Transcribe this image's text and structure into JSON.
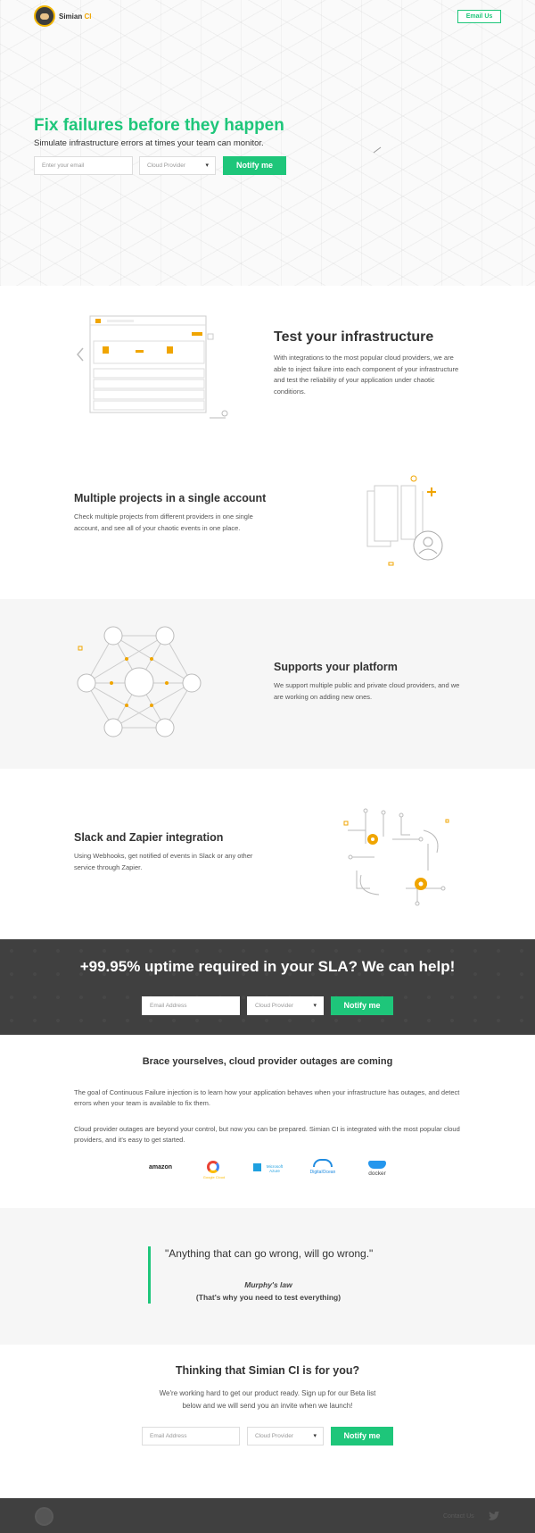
{
  "header": {
    "brand_main": "Simian",
    "brand_accent": "CI",
    "email_us": "Email Us"
  },
  "hero": {
    "title": "Fix failures before they happen",
    "subtitle": "Simulate infrastructure errors at times your team can monitor.",
    "email_placeholder": "Enter your email",
    "provider": "Cloud Provider",
    "notify": "Notify me"
  },
  "features": [
    {
      "title": "Test your infrastructure",
      "text": "With integrations to the most popular cloud providers, we are able to inject failure into each component of your infrastructure and test the reliability of your application under chaotic conditions."
    },
    {
      "title": "Multiple projects in a single account",
      "text": "Check multiple projects from different providers in one single account, and see all of your chaotic events in one place."
    },
    {
      "title": "Supports your platform",
      "text": "We support multiple public and private cloud providers, and we are working on adding new ones."
    },
    {
      "title": "Slack and Zapier integration",
      "text": "Using Webhooks, get notified of events in Slack or any other service through Zapier."
    }
  ],
  "cta": {
    "title": "+99.95% uptime required in your SLA? We can help!",
    "email_placeholder": "Email Address",
    "provider": "Cloud Provider",
    "notify": "Notify me"
  },
  "outages": {
    "title": "Brace yourselves, cloud provider outages are coming",
    "p1": "The goal of Continuous Failure injection is to learn how your application behaves when your infrastructure has outages, and detect errors when your team is available to fix them.",
    "p2": "Cloud provider outages are beyond your control, but now you can be prepared. Simian CI is integrated with the most popular cloud providers, and it's easy to get started.",
    "logos": [
      "amazon",
      "Google Cloud",
      "Microsoft Azure",
      "DigitalOcean",
      "docker"
    ]
  },
  "quote": {
    "text": "\"Anything that can go wrong, will go wrong.\"",
    "author": "Murphy's law",
    "note": "(That's why you need to test everything)"
  },
  "signup": {
    "title": "Thinking that Simian CI is for you?",
    "text": "We're working hard to get our product ready. Sign up for our Beta list below and we will send you an invite when we launch!",
    "email_placeholder": "Email Address",
    "provider": "Cloud Provider",
    "notify": "Notify me"
  },
  "footer": {
    "contact": "Contact Us"
  },
  "colors": {
    "green": "#1ec67a",
    "orange": "#f0a500",
    "dark": "#404040"
  }
}
